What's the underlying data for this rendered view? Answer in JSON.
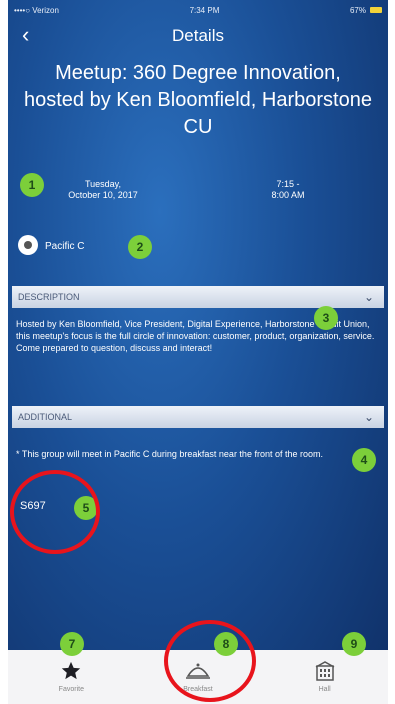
{
  "status": {
    "carrier": "••••○ Verizon",
    "time": "7:34 PM",
    "battery": "67%"
  },
  "nav": {
    "back": "‹",
    "title": "Details"
  },
  "event": {
    "title": "Meetup: 360 Degree Innovation, hosted by Ken Bloomfield, Harborstone CU",
    "date_line1": "Tuesday,",
    "date_line2": "October 10, 2017",
    "time_line1": "7:15 -",
    "time_line2": "8:00 AM",
    "location": "Pacific C"
  },
  "description": {
    "label": "DESCRIPTION",
    "text": "Hosted by Ken Bloomfield, Vice President, Digital Experience, Harborstone Credit Union, this meetup's focus is the full circle of innovation: customer, product, organization, service. Come prepared to question, discuss and interact!"
  },
  "additional": {
    "label": "ADDITIONAL",
    "text": "* This group will meet in Pacific C during breakfast near the front of the room."
  },
  "session_code": "S697",
  "badges": [
    "1",
    "2",
    "3",
    "4",
    "5",
    "7",
    "8",
    "9"
  ],
  "tabs": [
    {
      "label": "Favorite",
      "icon": "star-icon"
    },
    {
      "label": "Breakfast",
      "icon": "cloche-icon"
    },
    {
      "label": "Hall",
      "icon": "building-icon"
    }
  ],
  "colors": {
    "badge": "#7ccf3a",
    "ring": "#e8141c",
    "background": "#1a4f96"
  }
}
